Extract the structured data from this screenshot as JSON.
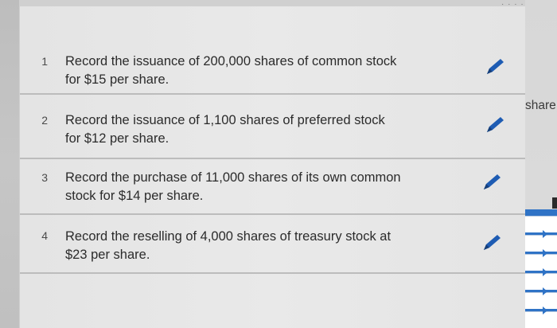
{
  "journal_rows": [
    {
      "num": "1",
      "line1": "Record the issuance of 200,000 shares of common stock",
      "line2": "for $15 per share."
    },
    {
      "num": "2",
      "line1": "Record the issuance of 1,100 shares of preferred stock",
      "line2": "for $12 per share."
    },
    {
      "num": "3",
      "line1": "Record the purchase of 11,000 shares of its own common",
      "line2": "stock for $14 per share."
    },
    {
      "num": "4",
      "line1": "Record the reselling of 4,000 shares of treasury stock at",
      "line2": "$23 per share."
    }
  ],
  "right_panel": {
    "partial_label": "share"
  },
  "icons": {
    "edit": "pencil-icon"
  },
  "colors": {
    "accent": "#2f73c6",
    "pencil": "#1e5cb3",
    "row_bg": "#e7e7e7",
    "divider": "#bcbcbc"
  }
}
